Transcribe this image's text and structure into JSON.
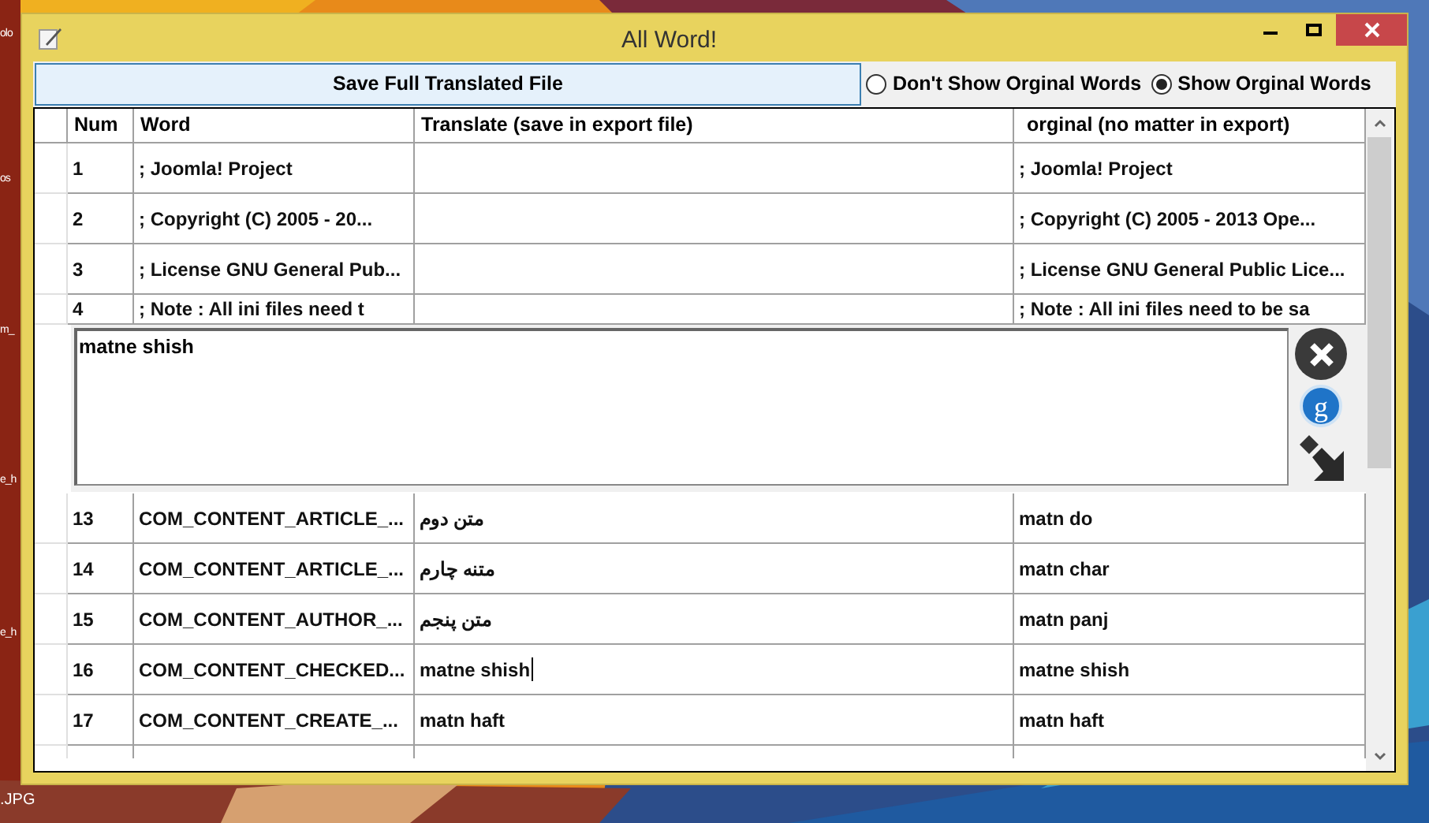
{
  "desktop_labels": [
    "olo",
    "os",
    "m_",
    "e_h",
    "e_h",
    ".JPG"
  ],
  "window": {
    "title": "All Word!"
  },
  "save_button": {
    "label": "Save Full Translated File"
  },
  "view_options": [
    {
      "label": "Don't Show Orginal Words",
      "selected": false
    },
    {
      "label": "Show Orginal Words",
      "selected": true
    }
  ],
  "table": {
    "columns": [
      "Num",
      "Word",
      "Translate (save in export file)",
      "orginal (no matter in export)"
    ],
    "rows_before": [
      {
        "num": "1",
        "word": "; Joomla! Project",
        "original": "; Joomla! Project",
        "editing": false
      },
      {
        "num": "2",
        "word": "; Copyright (C) 2005 - 20...",
        "original": "; Copyright (C) 2005 - 2013 Ope...",
        "editing": false
      },
      {
        "num": "3",
        "word": "; License GNU General Pub...",
        "original": "; License GNU General Public Lice...",
        "editing": false
      },
      {
        "num": "4",
        "word": "; Note : All ini files need t",
        "original": "; Note : All ini files need to be sa",
        "editing": false
      }
    ],
    "editor": {
      "value": "matne shish",
      "translate_button": "g"
    },
    "rows_after": [
      {
        "num": "13",
        "word": "COM_CONTENT_ARTICLE_...",
        "translate": "متن دوم",
        "original": "matn do",
        "editing": false
      },
      {
        "num": "14",
        "word": "COM_CONTENT_ARTICLE_...",
        "translate": "متنه چارم",
        "original": "matn char",
        "editing": false
      },
      {
        "num": "15",
        "word": "COM_CONTENT_AUTHOR_...",
        "translate": "متن پنجم",
        "original": "matn panj",
        "editing": false
      },
      {
        "num": "16",
        "word": "COM_CONTENT_CHECKED...",
        "translate": "matne shish",
        "original": "matne shish",
        "editing": true
      },
      {
        "num": "17",
        "word": "COM_CONTENT_CREATE_...",
        "translate": "matn haft",
        "original": "matn haft",
        "editing": false
      }
    ]
  }
}
